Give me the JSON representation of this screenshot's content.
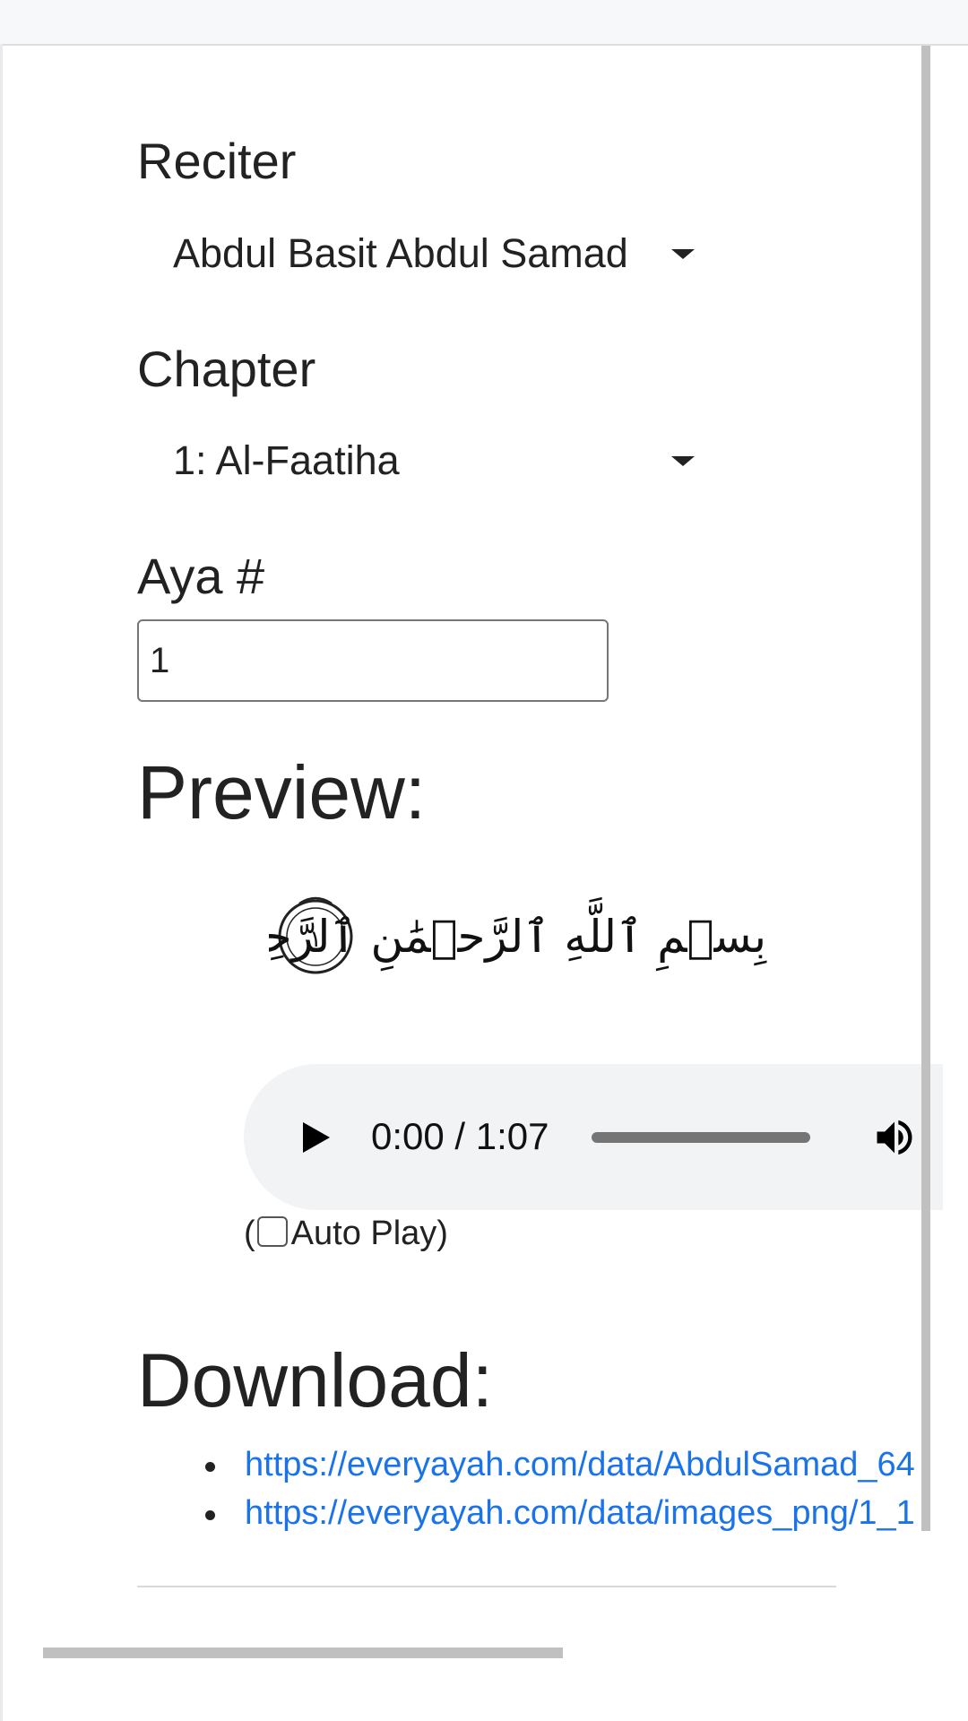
{
  "form": {
    "reciter_label": "Reciter",
    "reciter_value": "Abdul Basit Abdul Samad",
    "chapter_label": "Chapter",
    "chapter_value": "1: Al-Faatiha",
    "aya_label": "Aya #",
    "aya_value": "1"
  },
  "preview": {
    "heading": "Preview:",
    "verse_text": "بِسۡمِ ٱللَّهِ ٱلرَّحۡمَٰنِ ٱلرَّحِيمِ",
    "verse_number": "١"
  },
  "audio": {
    "time": "0:00 / 1:07",
    "progress": 0
  },
  "autoplay": {
    "open_paren": "(",
    "label": " Auto Play)",
    "checked": false
  },
  "download": {
    "heading": "Download:",
    "links": [
      "https://everyayah.com/data/AbdulSamad_64",
      "https://everyayah.com/data/images_png/1_1"
    ]
  },
  "icons": {
    "play": "play-icon",
    "volume": "volume-icon",
    "dropdown": "caret-down-icon"
  }
}
